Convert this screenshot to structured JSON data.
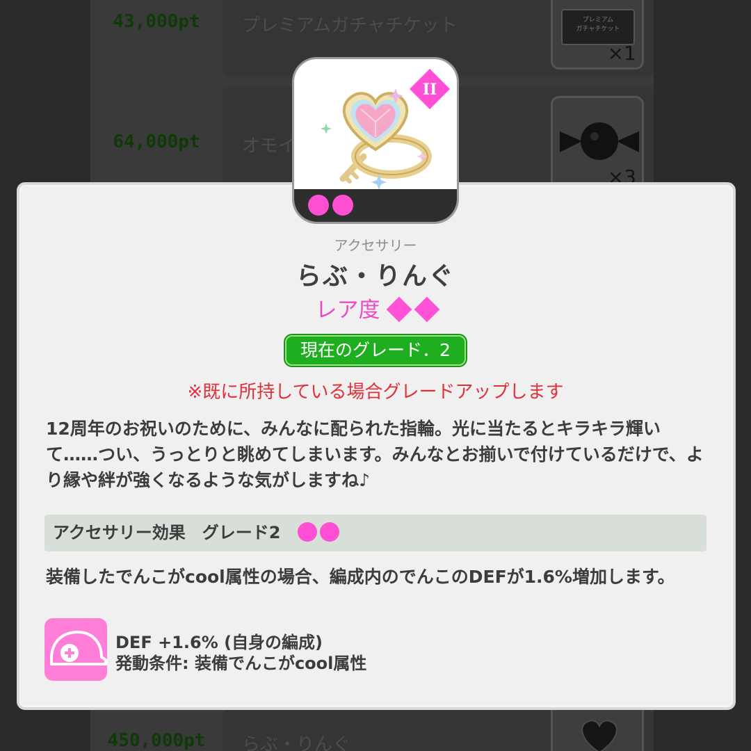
{
  "background_list": {
    "rows": [
      {
        "points": "43,000pt",
        "name": "プレミアムガチャチケット",
        "quantity": "×1",
        "thumb_text": "プレミアム\nガチャチケット",
        "thumb_icon": "ticket-icon"
      },
      {
        "points": "64,000pt",
        "name": "オモイ",
        "quantity": "×3",
        "thumb_icon": "candy-icon"
      },
      {
        "points": "450,000pt",
        "name": "らぶ・りんぐ",
        "quantity": "",
        "thumb_icon": "heart-ring-icon"
      }
    ]
  },
  "modal": {
    "item_icon": "heart-ring-icon",
    "grade_badge_label": "II",
    "category": "アクセサリー",
    "name": "らぶ・りんぐ",
    "rarity_label": "レア度",
    "rarity_count": 2,
    "current_grade": "現在のグレード．2",
    "warning": "※既に所持している場合グレードアップします",
    "description": "12周年のお祝いのために、みんなに配られた指輪。光に当たるとキラキラ輝いて……つい、うっとりと眺めてしまいます。みんなとお揃いで付けているだけで、より縁や絆が強くなるような気がしますね♪",
    "effect_header": "アクセサリー効果　グレード2",
    "effect_grade_dots": 2,
    "effect_text": "装備したでんこがcool属性の場合、編成内のでんこのDEFが1.6%増加します。",
    "stat_icon": "helmet-plus-icon",
    "stat_line1": "DEF +1.6% (自身の編成)",
    "stat_line2": "発動条件: 装備でんこがcool属性"
  },
  "colors": {
    "accent_pink": "#ff4fd2",
    "grade_green": "#1fae1f",
    "warning_red": "#e0303a",
    "points_green": "#0f3a08"
  }
}
